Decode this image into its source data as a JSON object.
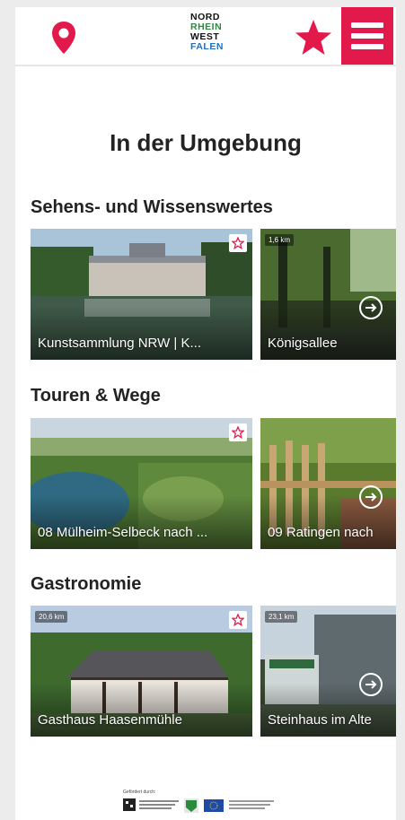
{
  "header": {
    "logo_lines": [
      "NORD",
      "RHEIN",
      "WEST",
      "FALEN"
    ],
    "icons": {
      "location": "map-pin-icon",
      "favorites": "star-icon",
      "menu": "hamburger-menu-icon"
    },
    "accent_color": "#e2194b"
  },
  "page_title": "In der Umgebung",
  "sections": [
    {
      "title": "Sehens- und Wissenswertes",
      "cards": [
        {
          "title": "Kunstsammlung NRW | K...",
          "distance": ""
        },
        {
          "title": "Königsallee",
          "distance": "1,6 km"
        }
      ]
    },
    {
      "title": "Touren & Wege",
      "cards": [
        {
          "title": "08 Mülheim-Selbeck nach ...",
          "distance": ""
        },
        {
          "title": "09 Ratingen nach",
          "distance": ""
        }
      ]
    },
    {
      "title": "Gastronomie",
      "cards": [
        {
          "title": "Gasthaus Haasenmühle",
          "distance": "20,6 km"
        },
        {
          "title": "Steinhaus im Alte",
          "distance": "23,1 km"
        }
      ]
    }
  ],
  "footer": {
    "label": "Gefördert durch:"
  }
}
